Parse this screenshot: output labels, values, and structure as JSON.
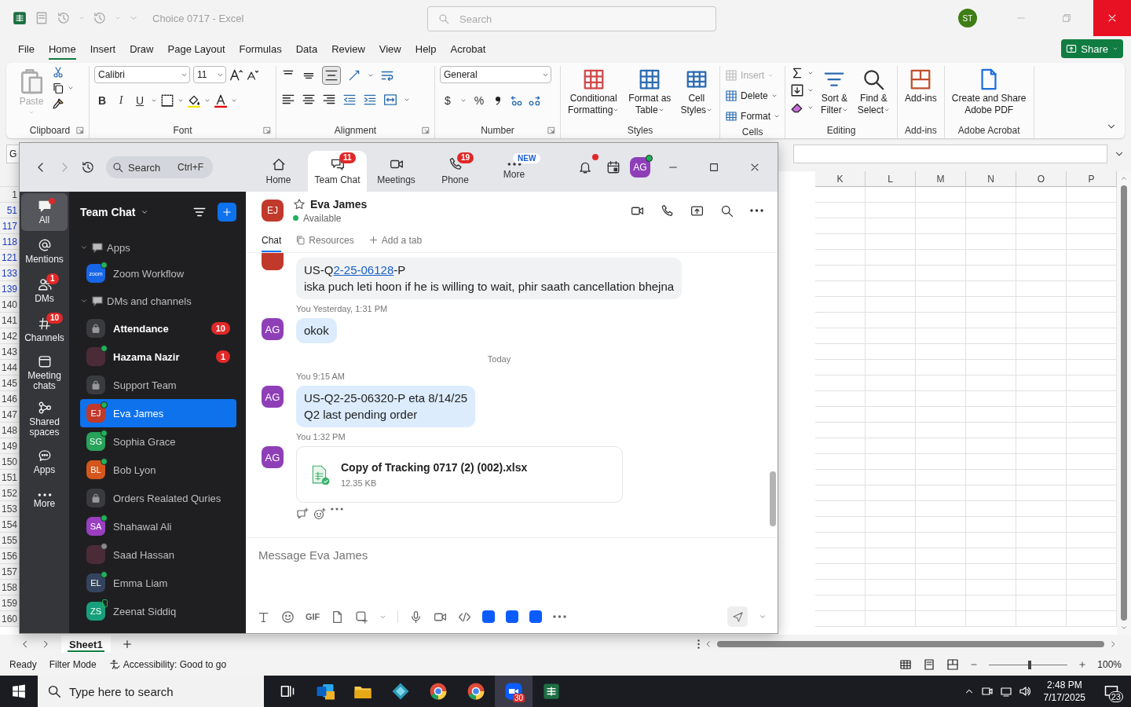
{
  "excel": {
    "title": "Choice 0717  -  Excel",
    "search": {
      "placeholder": "Search"
    },
    "account": {
      "initials": "ST",
      "color": "#3f7d15"
    },
    "menu_tabs": [
      {
        "label": "File",
        "selected": false
      },
      {
        "label": "Home",
        "selected": true
      },
      {
        "label": "Insert",
        "selected": false
      },
      {
        "label": "Draw",
        "selected": false
      },
      {
        "label": "Page Layout",
        "selected": false
      },
      {
        "label": "Formulas",
        "selected": false
      },
      {
        "label": "Data",
        "selected": false
      },
      {
        "label": "Review",
        "selected": false
      },
      {
        "label": "View",
        "selected": false
      },
      {
        "label": "Help",
        "selected": false
      },
      {
        "label": "Acrobat",
        "selected": false
      }
    ],
    "share": {
      "label": "Share"
    },
    "ribbon_groups": [
      {
        "kind": "clipboard",
        "label": "Clipboard",
        "paste": "Paste"
      },
      {
        "kind": "font",
        "label": "Font",
        "font": "Calibri",
        "size": "11",
        "bold": "B",
        "italic": "I",
        "underline": "U"
      },
      {
        "kind": "alignment",
        "label": "Alignment"
      },
      {
        "kind": "number",
        "label": "Number",
        "format": "General",
        "currency": "$",
        "percent": "%"
      },
      {
        "kind": "big",
        "label": "Styles",
        "buttons": [
          {
            "kind": "conditional",
            "lines": [
              "Conditional",
              "Formatting"
            ],
            "menu": true
          },
          {
            "kind": "table",
            "lines": [
              "Format as",
              "Table"
            ],
            "menu": true
          },
          {
            "kind": "cellstyles",
            "lines": [
              "Cell",
              "Styles"
            ],
            "menu": true
          }
        ]
      },
      {
        "kind": "cells",
        "label": "Cells",
        "items": [
          {
            "kind": "insert",
            "label": "Insert",
            "disabled": true
          },
          {
            "kind": "delete",
            "label": "Delete",
            "disabled": false
          },
          {
            "kind": "format",
            "label": "Format",
            "disabled": false
          }
        ]
      },
      {
        "kind": "editing",
        "label": "Editing",
        "buttons": [
          {
            "kind": "sort",
            "lines": [
              "Sort &",
              "Filter"
            ],
            "menu": true
          },
          {
            "kind": "find",
            "lines": [
              "Find &",
              "Select"
            ],
            "menu": true
          }
        ]
      },
      {
        "kind": "big",
        "label": "Add-ins",
        "buttons": [
          {
            "kind": "addins",
            "lines": [
              "Add-ins"
            ],
            "menu": false
          }
        ]
      },
      {
        "kind": "big",
        "label": "Adobe Acrobat",
        "buttons": [
          {
            "kind": "pdf",
            "lines": [
              "Create and Share",
              "Adobe PDF"
            ],
            "menu": false
          }
        ]
      }
    ],
    "name_box": "G",
    "sheet": {
      "columns": [
        "K",
        "L",
        "M",
        "N",
        "O",
        "P"
      ],
      "rows": [
        {
          "label": "1",
          "filtered": false
        },
        {
          "label": "51",
          "filtered": true
        },
        {
          "label": "117",
          "filtered": true
        },
        {
          "label": "118",
          "filtered": true
        },
        {
          "label": "121",
          "filtered": true
        },
        {
          "label": "133",
          "filtered": true
        },
        {
          "label": "139",
          "filtered": true
        },
        {
          "label": "140",
          "filtered": false
        },
        {
          "label": "141",
          "filtered": false
        },
        {
          "label": "142",
          "filtered": false
        },
        {
          "label": "143",
          "filtered": false
        },
        {
          "label": "144",
          "filtered": false
        },
        {
          "label": "145",
          "filtered": false
        },
        {
          "label": "146",
          "filtered": false
        },
        {
          "label": "147",
          "filtered": false
        },
        {
          "label": "148",
          "filtered": false
        },
        {
          "label": "149",
          "filtered": false
        },
        {
          "label": "150",
          "filtered": false
        },
        {
          "label": "151",
          "filtered": false
        },
        {
          "label": "152",
          "filtered": false
        },
        {
          "label": "153",
          "filtered": false
        },
        {
          "label": "154",
          "filtered": false
        },
        {
          "label": "155",
          "filtered": false
        },
        {
          "label": "156",
          "filtered": false
        },
        {
          "label": "157",
          "filtered": false
        },
        {
          "label": "158",
          "filtered": false
        },
        {
          "label": "159",
          "filtered": false
        },
        {
          "label": "160",
          "filtered": false
        }
      ]
    },
    "sheet_tabs": [
      {
        "label": "Sheet1",
        "selected": true
      }
    ],
    "status": {
      "items": [
        "Ready",
        "Filter Mode"
      ],
      "accessibility": "Accessibility: Good to go",
      "zoom_slider": {
        "level": 0.5
      },
      "zoom": "100%"
    }
  },
  "zoom": {
    "search": {
      "placeholder": "Search",
      "shortcut": "Ctrl+F"
    },
    "nav_tabs": [
      {
        "kind": "home",
        "label": "Home",
        "selected": false
      },
      {
        "kind": "chat",
        "label": "Team Chat",
        "selected": true,
        "badge": "11"
      },
      {
        "kind": "meetings",
        "label": "Meetings",
        "selected": false
      },
      {
        "kind": "phone",
        "label": "Phone",
        "selected": false,
        "badge": "19"
      },
      {
        "kind": "more",
        "label": "More",
        "selected": false,
        "tag": "NEW"
      }
    ],
    "bell": {
      "unread": true
    },
    "account": {
      "initials": "AG",
      "color": "#8e3fb8"
    },
    "rail": [
      {
        "kind": "all",
        "label": "All",
        "selected": true,
        "dot": true
      },
      {
        "kind": "mentions",
        "label": "Mentions",
        "selected": false
      },
      {
        "kind": "dms",
        "label": "DMs",
        "selected": false,
        "badge": "1"
      },
      {
        "kind": "channels",
        "label": "Channels",
        "selected": false,
        "badge": "10"
      },
      {
        "kind": "meeting",
        "label": "Meeting chats",
        "selected": false
      },
      {
        "kind": "shared",
        "label": "Shared spaces",
        "selected": false
      },
      {
        "kind": "apps",
        "label": "Apps",
        "selected": false
      },
      {
        "kind": "more",
        "label": "More",
        "selected": false
      }
    ],
    "list": {
      "title": "Team Chat",
      "sections": [
        {
          "label": "Apps",
          "expanded": true,
          "items": [
            {
              "kind": "app",
              "name": "Zoom Workflow",
              "logo_text": "zoom",
              "presence": {
                "kind": "online"
              },
              "unread": false,
              "selected": false
            }
          ]
        },
        {
          "label": "DMs and channels",
          "expanded": true,
          "items": [
            {
              "kind": "channel",
              "name": "Attendance",
              "unread": true,
              "selected": false,
              "badge": "10"
            },
            {
              "kind": "photo",
              "name": "Hazama Nazir",
              "presence": {
                "kind": "online"
              },
              "unread": true,
              "selected": false,
              "badge": "1"
            },
            {
              "kind": "channel",
              "name": "Support Team",
              "unread": false,
              "selected": false
            },
            {
              "kind": "person",
              "name": "Eva James",
              "initials": "EJ",
              "color": "#c0392b",
              "presence": {
                "kind": "online"
              },
              "unread": false,
              "selected": true
            },
            {
              "kind": "person",
              "name": "Sophia Grace",
              "initials": "SG",
              "color": "#27a35a",
              "presence": {
                "kind": "online"
              },
              "unread": false,
              "selected": false
            },
            {
              "kind": "person",
              "name": "Bob Lyon",
              "initials": "BL",
              "color": "#d4561c",
              "presence": {
                "kind": "online"
              },
              "unread": false,
              "selected": false
            },
            {
              "kind": "channel",
              "name": "Orders Realated Quries",
              "unread": false,
              "selected": false
            },
            {
              "kind": "person",
              "name": "Shahawal Ali",
              "initials": "SA",
              "color": "#9a3fc0",
              "presence": {
                "kind": "online"
              },
              "unread": false,
              "selected": false
            },
            {
              "kind": "photo",
              "name": "Saad Hassan",
              "presence": {
                "kind": "away"
              },
              "unread": false,
              "selected": false
            },
            {
              "kind": "person",
              "name": "Emma Liam",
              "initials": "EL",
              "color": "#34445e",
              "presence": {
                "kind": "online"
              },
              "unread": false,
              "selected": false
            },
            {
              "kind": "person",
              "name": "Zeenat Siddiq",
              "initials": "ZS",
              "color": "#17a07c",
              "presence": {
                "kind": "mobile"
              },
              "unread": false,
              "selected": false
            }
          ]
        }
      ]
    },
    "chat": {
      "contact": {
        "initials": "EJ",
        "color": "#c0392b",
        "name": "Eva James",
        "status": "Available",
        "starred": false
      },
      "tabs": [
        {
          "kind": "chat",
          "label": "Chat",
          "selected": true
        },
        {
          "kind": "resources",
          "label": "Resources",
          "selected": false
        },
        {
          "kind": "add",
          "label": "Add a tab",
          "selected": false
        }
      ],
      "messages": [
        {
          "kind": "text",
          "mine": false,
          "avatar": {
            "color": "#c0392b"
          },
          "lines": [
            [
              {
                "text": "US-Q"
              },
              {
                "text": "2-25-06128",
                "link": true
              },
              {
                "text": "-P"
              }
            ],
            [
              {
                "text": "iska puch leti hoon if he is willing to wait, phir saath cancellation bhejna"
              }
            ]
          ]
        },
        {
          "kind": "text",
          "mine": true,
          "author": "You",
          "time": "Yesterday, 1:31 PM",
          "avatar": {
            "initials": "AG",
            "color": "#8e3fb8"
          },
          "lines": [
            [
              {
                "text": "okok"
              }
            ]
          ]
        },
        {
          "kind": "divider",
          "label": "Today"
        },
        {
          "kind": "text",
          "mine": true,
          "author": "You",
          "time": "9:15 AM",
          "avatar": {
            "initials": "AG",
            "color": "#8e3fb8"
          },
          "lines": [
            [
              {
                "text": "US-Q2-25-06320-P eta 8/14/25"
              }
            ],
            [
              {
                "text": "Q2 last pending order"
              }
            ]
          ]
        },
        {
          "kind": "file",
          "mine": true,
          "author": "You",
          "time": "1:32 PM",
          "avatar": {
            "initials": "AG",
            "color": "#8e3fb8"
          },
          "file_name": "Copy of Tracking 0717 (2) (002).xlsx",
          "size": "12.35 KB"
        }
      ],
      "composer": {
        "placeholder": "Message Eva James",
        "gif": "GIF"
      }
    }
  },
  "taskbar": {
    "search": {
      "placeholder": "Type here to search"
    },
    "apps": [
      {
        "kind": "taskview",
        "selected": false
      },
      {
        "kind": "outlook",
        "selected": false
      },
      {
        "kind": "explorer",
        "selected": false
      },
      {
        "kind": "kite",
        "selected": false
      },
      {
        "kind": "chrome",
        "selected": false
      },
      {
        "kind": "chrome",
        "selected": false
      },
      {
        "kind": "zoom",
        "selected": true,
        "badge": "30"
      },
      {
        "kind": "excel",
        "selected": false
      }
    ],
    "time": "2:48 PM",
    "date": "7/17/2025",
    "notifications": "23"
  }
}
